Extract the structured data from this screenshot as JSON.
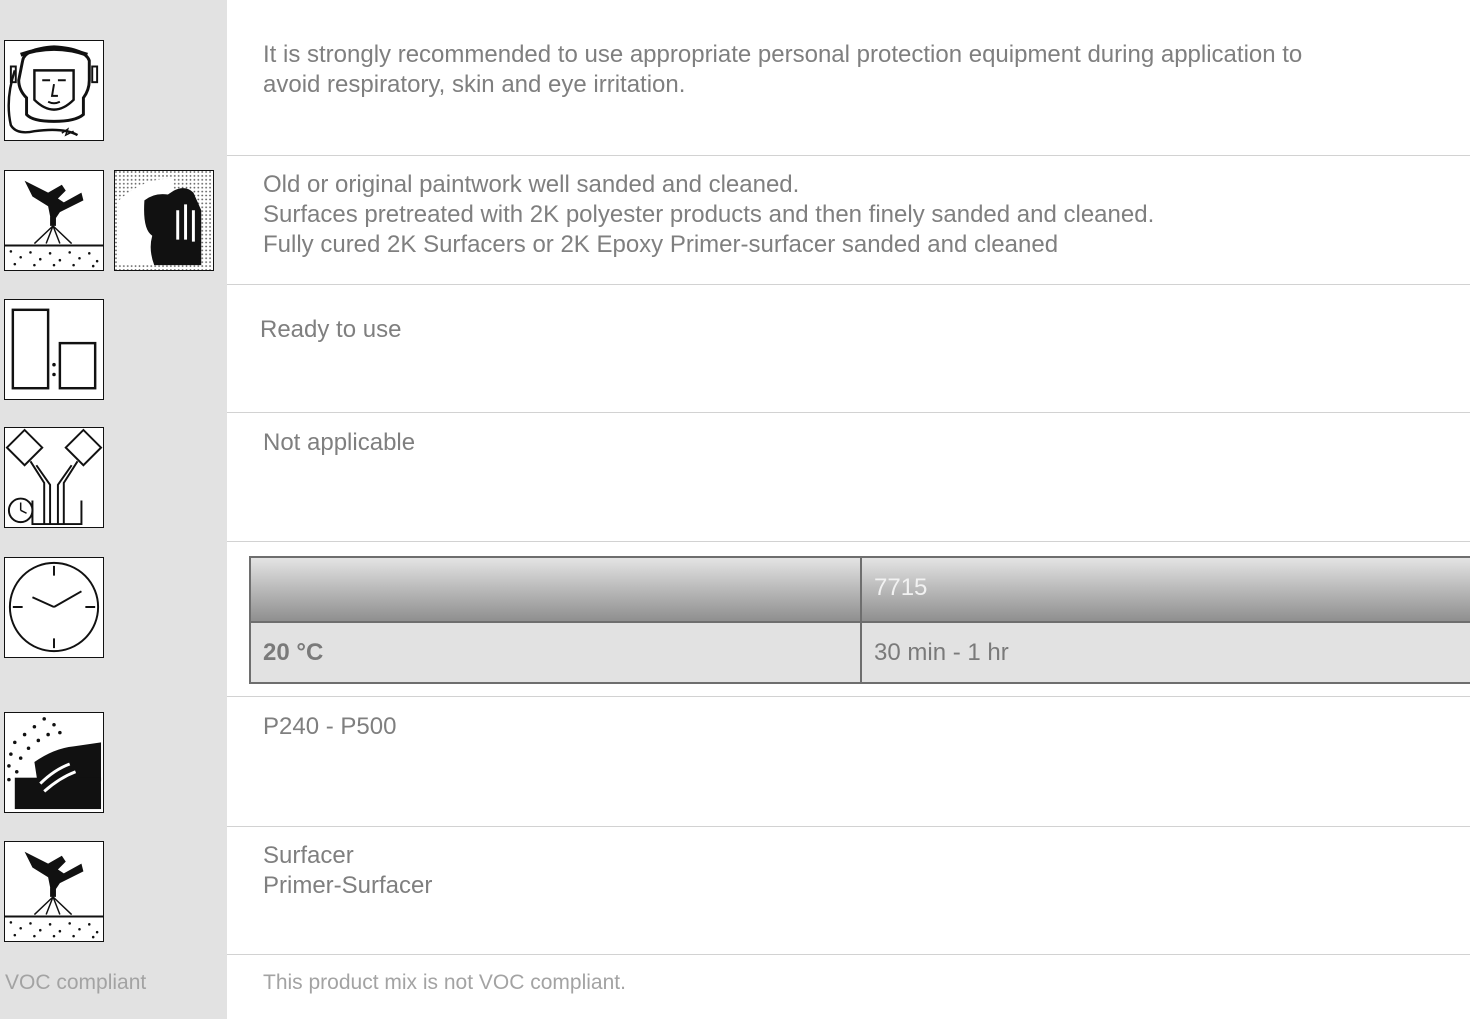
{
  "rows": [
    {
      "id": "protection",
      "icon": "face-shield-icon",
      "lines": [
        "It is strongly recommended to use appropriate personal protection equipment during application to",
        "avoid respiratory, skin and eye irritation."
      ]
    },
    {
      "id": "substrates",
      "icons": [
        "spray-gun-sanding-icon",
        "hand-cleaning-icon"
      ],
      "lines": [
        "Old or original paintwork well sanded and cleaned.",
        "Surfaces pretreated with 2K polyester products and then finely sanded and cleaned.",
        "Fully cured 2K Surfacers or 2K Epoxy Primer-surfacer sanded and cleaned"
      ]
    },
    {
      "id": "mixing-ratio",
      "icon": "mixing-ratio-icon",
      "lines": [
        "Ready to use"
      ]
    },
    {
      "id": "pot-life",
      "icon": "pot-life-icon",
      "lines": [
        "Not applicable"
      ]
    },
    {
      "id": "drying",
      "icon": "clock-icon",
      "table": {
        "header": [
          "",
          "7715"
        ],
        "rows": [
          [
            "20 °C",
            "30 min - 1 hr"
          ]
        ]
      }
    },
    {
      "id": "sanding",
      "icon": "sanding-icon",
      "lines": [
        "P240 - P500"
      ]
    },
    {
      "id": "topcoats",
      "icon": "spray-gun-icon",
      "lines": [
        "Surfacer",
        "Primer-Surfacer"
      ]
    },
    {
      "id": "voc",
      "label": "VOC compliant",
      "lines": [
        "This product mix is not VOC compliant."
      ]
    }
  ]
}
